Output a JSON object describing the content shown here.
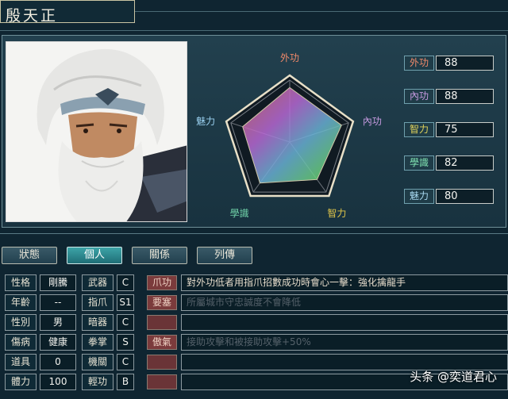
{
  "character": {
    "name": "殷天正"
  },
  "radar": {
    "labels": [
      {
        "text": "外功",
        "color": "#f28a6a"
      },
      {
        "text": "內功",
        "color": "#c69ae0"
      },
      {
        "text": "智力",
        "color": "#e0c64a"
      },
      {
        "text": "學識",
        "color": "#6fd0a8"
      },
      {
        "text": "魅力",
        "color": "#9ad0f0"
      }
    ],
    "values": [
      88,
      88,
      75,
      82,
      80
    ],
    "max": 100
  },
  "stats": [
    {
      "label": "外功",
      "value": "88",
      "color": "#f28a6a"
    },
    {
      "label": "內功",
      "value": "88",
      "color": "#c69ae0"
    },
    {
      "label": "智力",
      "value": "75",
      "color": "#e0d25a"
    },
    {
      "label": "學識",
      "value": "82",
      "color": "#7fe0b0"
    },
    {
      "label": "魅力",
      "value": "80",
      "color": "#a8d8f0"
    }
  ],
  "tabs": [
    {
      "label": "狀態",
      "active": false
    },
    {
      "label": "個人",
      "active": true
    },
    {
      "label": "關係",
      "active": false
    },
    {
      "label": "列傳",
      "active": false
    }
  ],
  "personal": [
    {
      "label": "性格",
      "value": "剛騰"
    },
    {
      "label": "年齡",
      "value": "--"
    },
    {
      "label": "性別",
      "value": "男"
    },
    {
      "label": "傷病",
      "value": "健康"
    },
    {
      "label": "道具",
      "value": "0"
    },
    {
      "label": "體力",
      "value": "100"
    }
  ],
  "weapons": [
    {
      "label": "武器",
      "grade": "C"
    },
    {
      "label": "指爪",
      "grade": "S1"
    },
    {
      "label": "暗器",
      "grade": "C"
    },
    {
      "label": "拳掌",
      "grade": "S"
    },
    {
      "label": "機關",
      "grade": "C"
    },
    {
      "label": "輕功",
      "grade": "B"
    }
  ],
  "skills": [
    {
      "tag": "爪功",
      "desc": "對外功低者用指爪招數成功時會心一擊：強化擒龍手",
      "dim": false
    },
    {
      "tag": "要塞",
      "desc": "所屬城市守忠誠度不會降低",
      "dim": true
    },
    {
      "tag": "",
      "desc": "",
      "dim": false
    },
    {
      "tag": "傲氣",
      "desc": "接助攻擊和被接助攻擊+50%",
      "dim": true
    },
    {
      "tag": "",
      "desc": "",
      "dim": false
    },
    {
      "tag": "",
      "desc": "",
      "dim": false
    }
  ],
  "watermark": "头条 @奕道君心"
}
